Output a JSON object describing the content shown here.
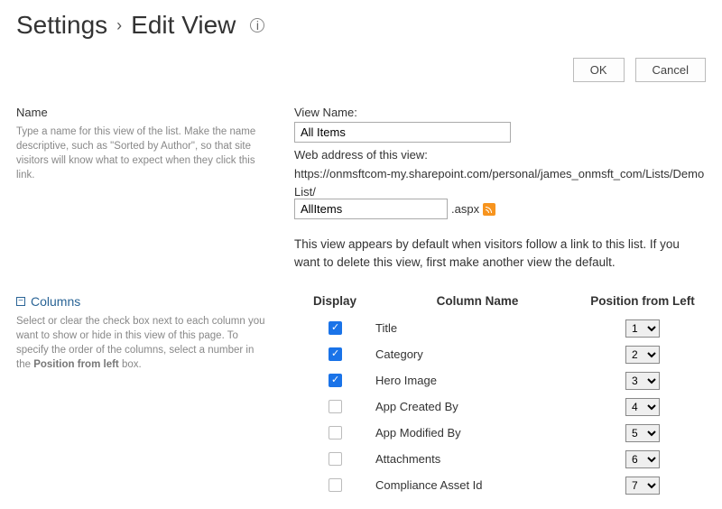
{
  "header": {
    "crumb1": "Settings",
    "crumb2": "Edit View"
  },
  "buttons": {
    "ok": "OK",
    "cancel": "Cancel"
  },
  "name_section": {
    "title": "Name",
    "description": "Type a name for this view of the list. Make the name descriptive, such as \"Sorted by Author\", so that site visitors will know what to expect when they click this link.",
    "view_name_label": "View Name:",
    "view_name_value": "All Items",
    "web_addr_label": "Web address of this view:",
    "web_addr_prefix": "https://onmsftcom-my.sharepoint.com/personal/james_onmsft_com/Lists/Demo List/",
    "web_addr_filename": "AllItems",
    "web_addr_ext": ".aspx",
    "default_note": "This view appears by default when visitors follow a link to this list. If you want to delete this view, first make another view the default."
  },
  "columns_section": {
    "title": "Columns",
    "description_pre": "Select or clear the check box next to each column you want to show or hide in this view of this page. To specify the order of the columns, select a number in the ",
    "description_bold": "Position from left",
    "description_post": " box.",
    "head_display": "Display",
    "head_colname": "Column Name",
    "head_pos": "Position from Left",
    "rows": [
      {
        "checked": true,
        "name": "Title",
        "pos": "1"
      },
      {
        "checked": true,
        "name": "Category",
        "pos": "2"
      },
      {
        "checked": true,
        "name": "Hero Image",
        "pos": "3"
      },
      {
        "checked": false,
        "name": "App Created By",
        "pos": "4"
      },
      {
        "checked": false,
        "name": "App Modified By",
        "pos": "5"
      },
      {
        "checked": false,
        "name": "Attachments",
        "pos": "6"
      },
      {
        "checked": false,
        "name": "Compliance Asset Id",
        "pos": "7"
      }
    ]
  }
}
